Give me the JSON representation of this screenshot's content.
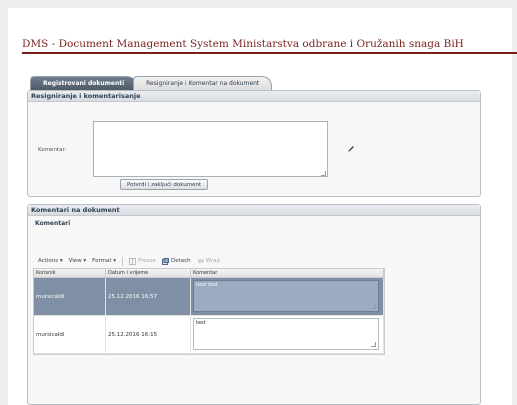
{
  "header": {
    "title": "DMS - Document Management System Ministarstva odbrane i Oružanih snaga BiH"
  },
  "tabs": [
    {
      "label": "Registrovani dokumenti"
    },
    {
      "label": "Resigniranje i Komentar na dokument"
    }
  ],
  "resign_panel": {
    "title": "Resigniranje i komentarisanje",
    "comment_label": "Komentar:",
    "comment_value": "",
    "button_label": "Potvrdi i zaključi dokument"
  },
  "comments_panel": {
    "title": "Komentari na dokument",
    "subtitle": "Komentari",
    "toolbar": {
      "actions": "Actions ▾",
      "view": "View ▾",
      "format": "Format ▾",
      "freeze": "Freeze",
      "detach": "Detach",
      "wrap": "Wrap"
    },
    "columns": [
      "Korisnik",
      "Datum i vrijeme",
      "Komentar"
    ],
    "rows": [
      {
        "user": "mursicaldi",
        "datetime": "25.12.2016 16:57",
        "comment": "novi test"
      },
      {
        "user": "mursicaldi",
        "datetime": "25.12.2016 16:15",
        "comment": "test"
      }
    ]
  },
  "colors": {
    "accent": "#7a1f1f",
    "selected_row": "#7e8fa6"
  }
}
